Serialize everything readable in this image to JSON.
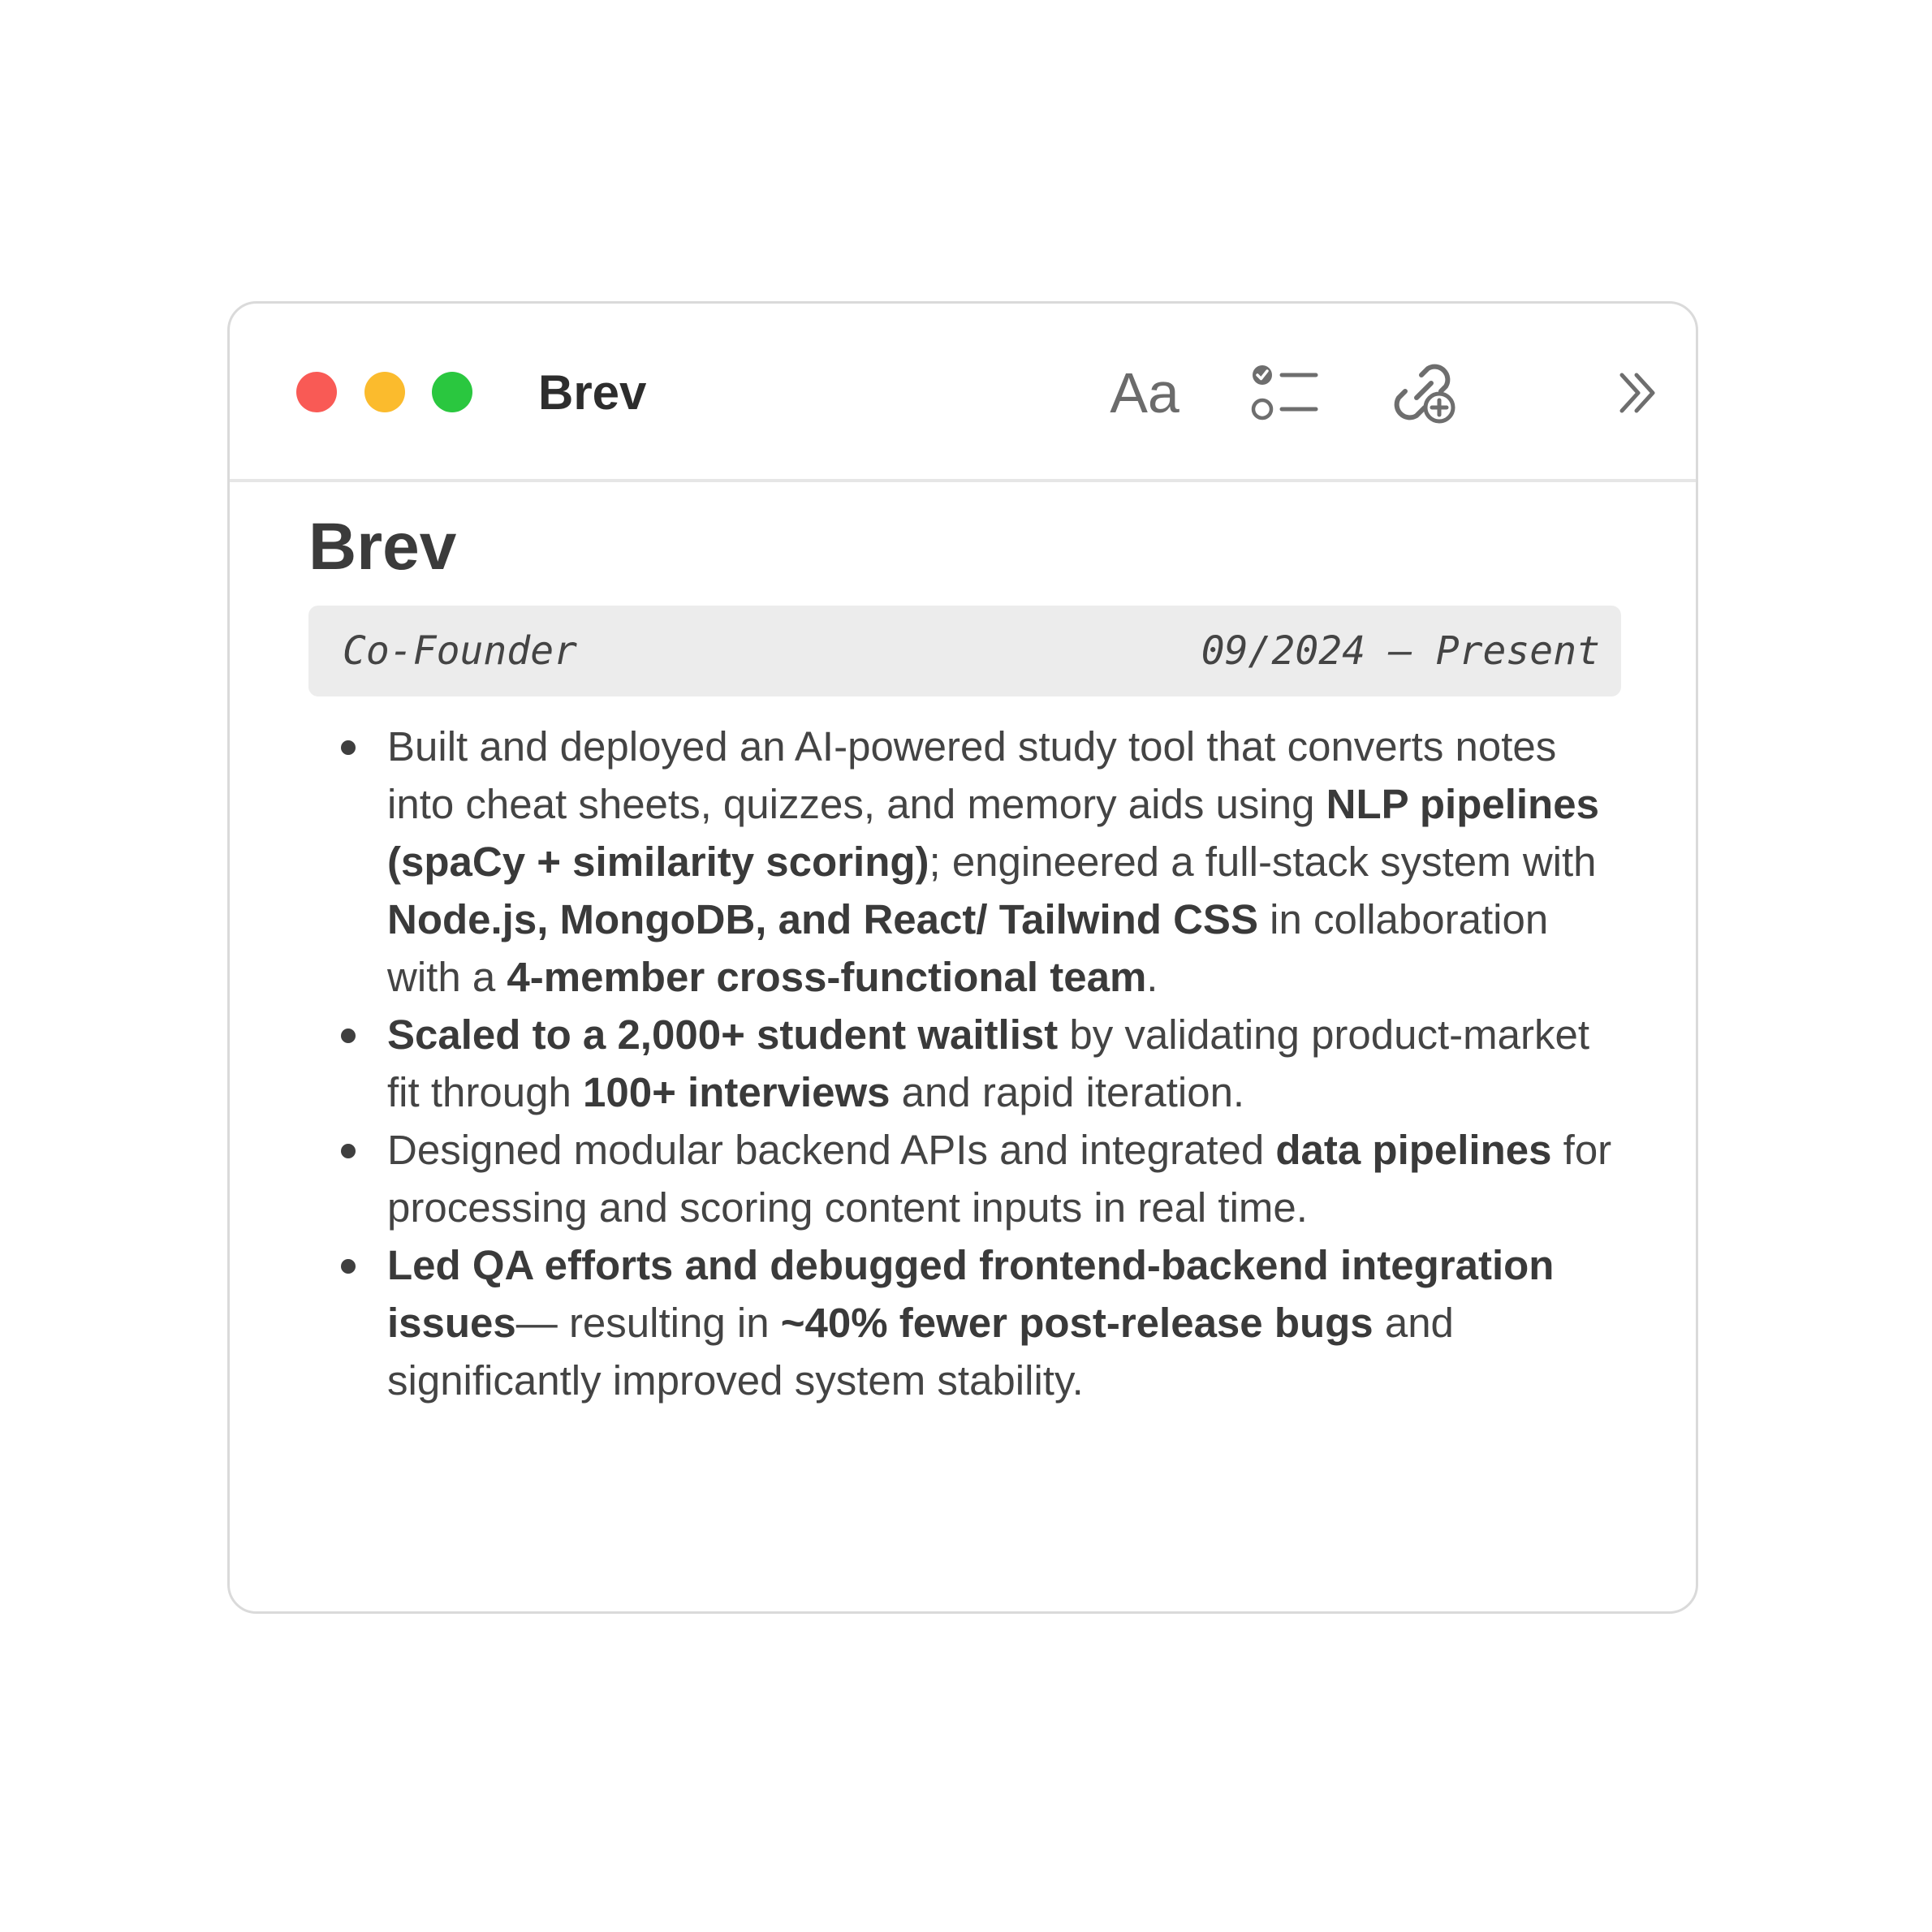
{
  "window": {
    "title": "Brev",
    "toolbar": {
      "font_icon_label": "Aa",
      "icons": [
        "format-text-icon",
        "checklist-icon",
        "link-add-icon",
        "chevron-double-right-icon"
      ]
    }
  },
  "document": {
    "heading": "Brev",
    "role": "Co-Founder",
    "dates": "09/2024 — Present",
    "bullets": [
      [
        {
          "t": "Built and deployed an AI-powered study tool that converts notes into cheat sheets, quizzes, and memory aids using ",
          "b": false
        },
        {
          "t": "NLP pipelines (spaCy + similarity scoring)",
          "b": true
        },
        {
          "t": "; engineered a full-stack system with ",
          "b": false
        },
        {
          "t": "Node.js, MongoDB, and React/ Tailwind CSS",
          "b": true
        },
        {
          "t": " in collaboration with a ",
          "b": false
        },
        {
          "t": "4-member cross-functional team",
          "b": true
        },
        {
          "t": ".",
          "b": false
        }
      ],
      [
        {
          "t": "Scaled to a 2,000+ student waitlist",
          "b": true
        },
        {
          "t": " by validating product-market fit through ",
          "b": false
        },
        {
          "t": "100+ interviews",
          "b": true
        },
        {
          "t": " and rapid iteration.",
          "b": false
        }
      ],
      [
        {
          "t": "Designed modular backend APIs and integrated ",
          "b": false
        },
        {
          "t": "data pipelines",
          "b": true
        },
        {
          "t": " for processing and scoring content inputs in real time.",
          "b": false
        }
      ],
      [
        {
          "t": "Led QA efforts and debugged frontend-backend integration issues",
          "b": true
        },
        {
          "t": "— resulting in ",
          "b": false
        },
        {
          "t": "~40% fewer post-release bugs",
          "b": true
        },
        {
          "t": " and significantly improved system stability.",
          "b": false
        }
      ]
    ]
  },
  "colors": {
    "close": "#f95a55",
    "minimize": "#fbbb2d",
    "zoom": "#2ac73f",
    "role_bar_bg": "#ececec"
  }
}
